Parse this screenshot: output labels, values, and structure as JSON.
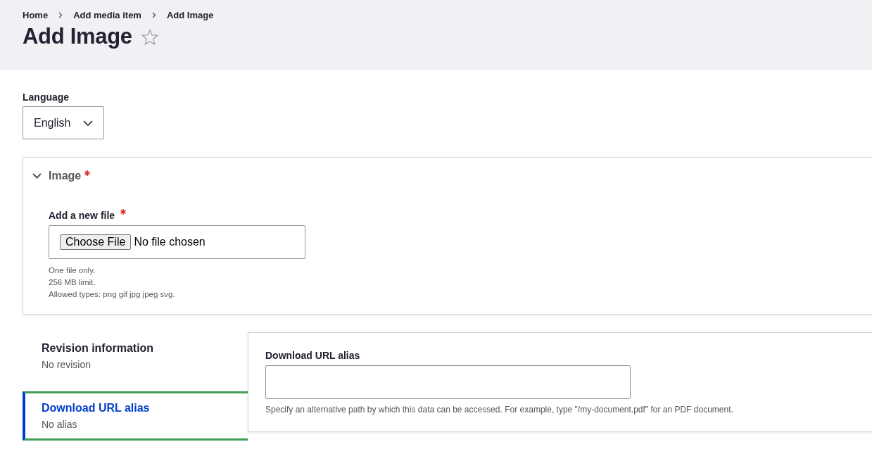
{
  "breadcrumb": [
    {
      "label": "Home"
    },
    {
      "label": "Add media item"
    },
    {
      "label": "Add Image"
    }
  ],
  "page_title": "Add Image",
  "favorite": {
    "starred": false
  },
  "language": {
    "label": "Language",
    "value": "English"
  },
  "image_details": {
    "title": "Image",
    "required": true,
    "expanded": true,
    "file_field": {
      "label": "Add a new file",
      "required": true,
      "button": "Choose File",
      "status": "No file chosen"
    },
    "help": [
      "One file only.",
      "256 MB limit.",
      "Allowed types: png gif jpg jpeg svg."
    ]
  },
  "vertical_tabs": [
    {
      "title": "Revision information",
      "summary": "No revision",
      "selected": false
    },
    {
      "title": "Download URL alias",
      "summary": "No alias",
      "selected": true
    }
  ],
  "alias_pane": {
    "label": "Download URL alias",
    "description": "Specify an alternative path by which this data can be accessed. For example, type \"/my-document.pdf\" for an PDF document."
  }
}
